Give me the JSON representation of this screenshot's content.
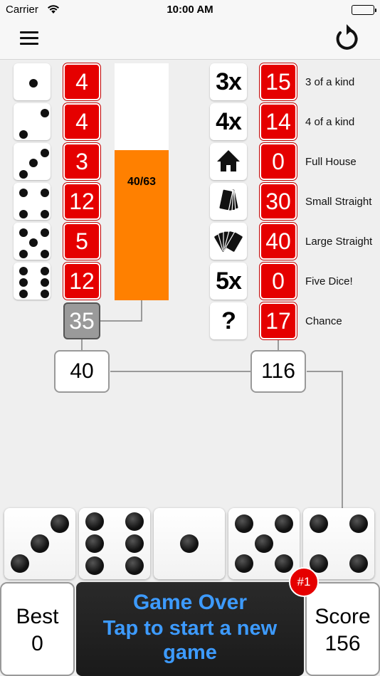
{
  "status_bar": {
    "carrier": "Carrier",
    "time": "10:00 AM"
  },
  "nav": {
    "menu_icon": "hamburger-menu-icon",
    "undo_icon": "undo-icon"
  },
  "upper": [
    {
      "face": 1,
      "score": "4"
    },
    {
      "face": 2,
      "score": "4"
    },
    {
      "face": 3,
      "score": "3"
    },
    {
      "face": 4,
      "score": "12"
    },
    {
      "face": 5,
      "score": "5"
    },
    {
      "face": 6,
      "score": "12"
    }
  ],
  "bonus": "35",
  "progress": {
    "text": "40/63",
    "fraction": 0.635
  },
  "lower": [
    {
      "symbol": "3x",
      "score": "15",
      "label": "3 of a kind"
    },
    {
      "symbol": "4x",
      "score": "14",
      "label": "4 of a kind"
    },
    {
      "icon": "house-icon",
      "score": "0",
      "label": "Full House"
    },
    {
      "icon": "four-cards-icon",
      "score": "30",
      "label": "Small Straight"
    },
    {
      "icon": "five-cards-icon",
      "score": "40",
      "label": "Large Straight"
    },
    {
      "symbol": "5x",
      "score": "0",
      "label": "Five Dice!"
    },
    {
      "symbol": "?",
      "score": "17",
      "label": "Chance"
    }
  ],
  "totals": {
    "upper": "40",
    "lower": "116"
  },
  "dice": [
    3,
    6,
    1,
    5,
    4
  ],
  "best": {
    "title": "Best",
    "value": "0"
  },
  "score": {
    "title": "Score",
    "value": "156"
  },
  "game_over": {
    "title": "Game Over",
    "subtitle": "Tap to start a new game"
  },
  "rank": "#1",
  "colors": {
    "score_red": "#e50000",
    "progress_orange": "#ff8000",
    "game_over_blue": "#3d9bff"
  }
}
